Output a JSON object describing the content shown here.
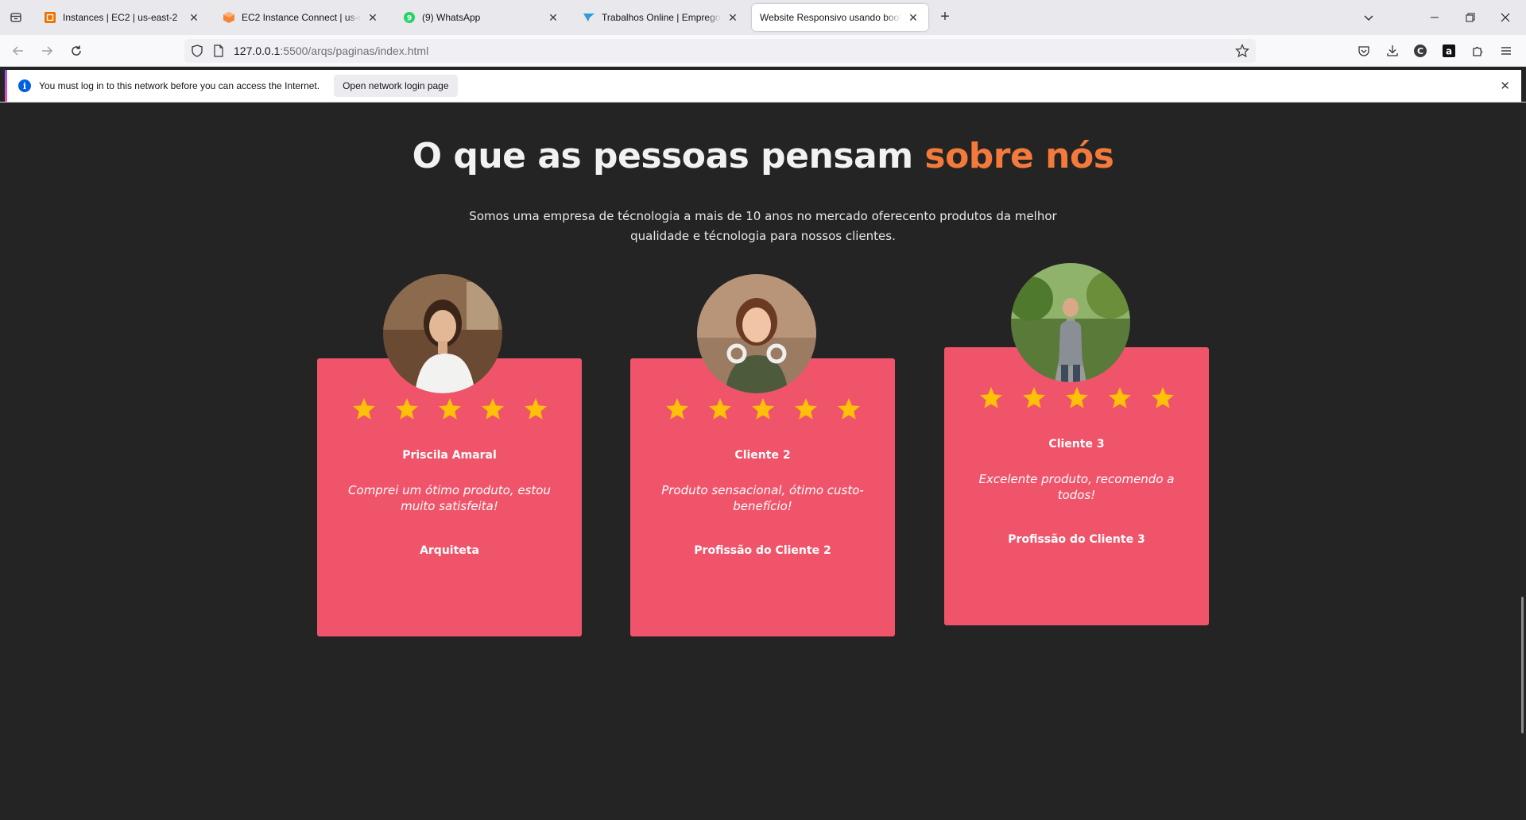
{
  "browser": {
    "tabs": [
      {
        "title": "Instances | EC2 | us-east-2",
        "icon": "aws-ec2-icon"
      },
      {
        "title": "EC2 Instance Connect | us-east-2",
        "icon": "aws-cube-icon"
      },
      {
        "title": "(9) WhatsApp",
        "icon": "whatsapp-icon"
      },
      {
        "title": "Trabalhos Online | Empregos de Freelancer",
        "icon": "workana-icon"
      },
      {
        "title": "Website Responsivo usando bootstrap",
        "icon": "page-icon",
        "active": true
      }
    ],
    "url": {
      "host": "127.0.0.1",
      "path": ":5500/arqs/paginas/index.html"
    },
    "notice": {
      "text": "You must log in to this network before you can access the Internet.",
      "button": "Open network login page"
    }
  },
  "page": {
    "heading": {
      "main": "O que as pessoas pensam ",
      "accent": "sobre nós"
    },
    "subtitle": "Somos uma empresa de técnologia a mais de 10 anos no mercado oferecento produtos da melhor qualidade e técnologia para nossos clientes.",
    "testimonials": [
      {
        "name": "Priscila Amaral",
        "quote": "Comprei um ótimo produto, estou muito satisfeita!",
        "role": "Arquiteta",
        "stars": 5
      },
      {
        "name": "Cliente 2",
        "quote": "Produto sensacional, ótimo custo-benefício!",
        "role": "Profissão do Cliente 2",
        "stars": 5
      },
      {
        "name": "Cliente 3",
        "quote": "Excelente produto, recomendo a todos!",
        "role": "Profissão do Cliente 3",
        "stars": 5
      }
    ]
  },
  "colors": {
    "card": "#f0546a",
    "accent": "#f47a3b",
    "star": "#ffc107",
    "background": "#242424"
  }
}
